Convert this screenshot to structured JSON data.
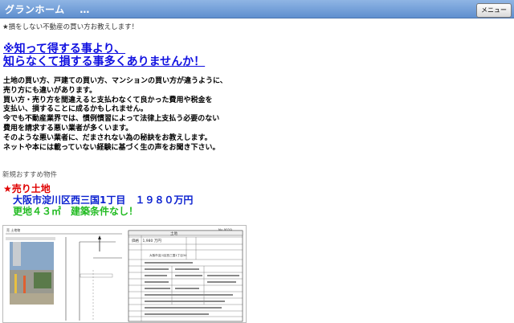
{
  "header": {
    "title": "グランホーム",
    "ellipsis": "…",
    "menu_label": "メニュー"
  },
  "tagline": "★損をしない不動産の買い方お教えします！",
  "headline": {
    "line1": "※知って得する事より、",
    "line2": "知らなくて損する事多くありませんか！"
  },
  "body_lines": [
    "土地の買い方、戸建ての買い方、マンションの買い方が違うように、",
    "売り方にも違いがあります。",
    "買い方・売り方を間違えると支払わなくて良かった費用や税金を",
    "支払い、損することに成るかもしれません。",
    "今でも不動産業界では、慣例慣習によって法律上支払う必要のない",
    "費用を請求する悪い業者が多くいます。",
    "そのような悪い業者に、だまされない為の秘訣をお教えします。",
    "ネットや本には載っていない経験に基づく生の声をお聞き下さい。"
  ],
  "section_label": "新規おすすめ物件",
  "property": {
    "type": "★売り土地",
    "location": "大阪市淀川区西三国1丁目　１９８０万円",
    "size": "更地４３㎡　建築条件なし！"
  },
  "flyer": {
    "left_label": "売 土地物",
    "top_right_label": "No.0019",
    "table_header": "土地",
    "price": "価格　1,980 万円",
    "address": "大阪市淀川区西三国1丁目34"
  }
}
